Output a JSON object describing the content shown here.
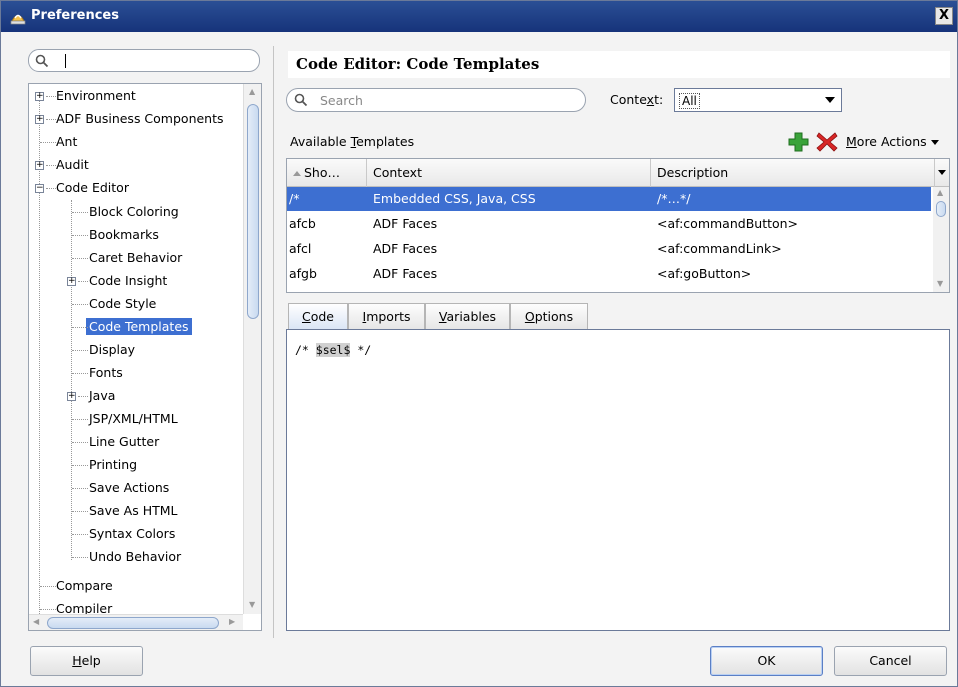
{
  "window": {
    "title": "Preferences",
    "close_label": "X"
  },
  "sidebar": {
    "search_value": "",
    "items": [
      {
        "label": "Environment",
        "expander": "+"
      },
      {
        "label": "ADF Business Components",
        "expander": "+"
      },
      {
        "label": "Ant",
        "expander": ""
      },
      {
        "label": "Audit",
        "expander": "+"
      },
      {
        "label": "Code Editor",
        "expander": "−"
      },
      {
        "label": "Block Coloring",
        "expander": ""
      },
      {
        "label": "Bookmarks",
        "expander": ""
      },
      {
        "label": "Caret Behavior",
        "expander": ""
      },
      {
        "label": "Code Insight",
        "expander": "+"
      },
      {
        "label": "Code Style",
        "expander": ""
      },
      {
        "label": "Code Templates",
        "expander": "",
        "selected": true
      },
      {
        "label": "Display",
        "expander": ""
      },
      {
        "label": "Fonts",
        "expander": ""
      },
      {
        "label": "Java",
        "expander": "+"
      },
      {
        "label": "JSP/XML/HTML",
        "expander": ""
      },
      {
        "label": "Line Gutter",
        "expander": ""
      },
      {
        "label": "Printing",
        "expander": ""
      },
      {
        "label": "Save Actions",
        "expander": ""
      },
      {
        "label": "Save As HTML",
        "expander": ""
      },
      {
        "label": "Syntax Colors",
        "expander": ""
      },
      {
        "label": "Undo Behavior",
        "expander": ""
      },
      {
        "label": "Compare",
        "expander": ""
      },
      {
        "label": "Compiler",
        "expander": ""
      }
    ]
  },
  "main": {
    "title": "Code Editor: Code Templates",
    "search_placeholder": "Search",
    "context_label_pre": "Conte",
    "context_label_u": "x",
    "context_label_post": "t:",
    "context_value": "All",
    "available_pre": "Available ",
    "available_u": "T",
    "available_post": "emplates",
    "more_actions_u": "M",
    "more_actions_rest": "ore Actions",
    "table": {
      "headers": [
        "Sho…",
        "Context",
        "Description"
      ],
      "rows": [
        {
          "shortcut": "/*",
          "context": "Embedded CSS, Java, CSS",
          "description": "/*…*/",
          "selected": true
        },
        {
          "shortcut": "afcb",
          "context": "ADF Faces",
          "description": "<af:commandButton>"
        },
        {
          "shortcut": "afcl",
          "context": "ADF Faces",
          "description": "<af:commandLink>"
        },
        {
          "shortcut": "afgb",
          "context": "ADF Faces",
          "description": "<af:goButton>"
        }
      ]
    },
    "tabs": [
      {
        "u": "C",
        "rest": "ode"
      },
      {
        "u": "I",
        "rest": "mports"
      },
      {
        "u": "V",
        "rest": "ariables"
      },
      {
        "u": "O",
        "rest": "ptions"
      }
    ],
    "code": {
      "prefix": "/* ",
      "variable": "$sel$",
      "suffix": " */"
    }
  },
  "footer": {
    "help_u": "H",
    "help_rest": "elp",
    "ok_label": "OK",
    "cancel_label": "Cancel"
  }
}
